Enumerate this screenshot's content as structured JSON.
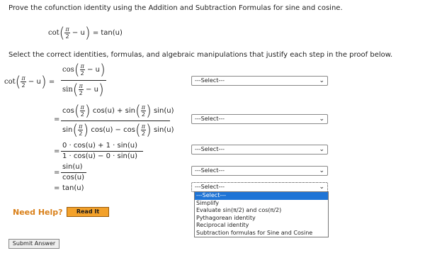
{
  "instruction": "Prove the cofunction identity using the Addition and Subtraction Formulas for sine and cosine.",
  "identity": {
    "lhs_fn": "cot",
    "pi": "π",
    "two": "2",
    "minus_u": "− u",
    "rhs": "= tan(u)"
  },
  "select_instruction": "Select the correct identities, formulas, and algebraic manipulations that justify each step in the proof below.",
  "proof": {
    "lhs_fn": "cot",
    "pi": "π",
    "two": "2",
    "minus_u": "− u",
    "eq": "=",
    "step1_num_fn": "cos",
    "step1_den_fn": "sin",
    "step2_num_a": "cos",
    "step2_num_b": "cos(u) + sin",
    "step2_num_c": "sin(u)",
    "step2_den_a": "sin",
    "step2_den_b": "cos(u) − cos",
    "step2_den_c": "sin(u)",
    "step3_num": "0 · cos(u) + 1 · sin(u)",
    "step3_den": "1 · cos(u) − 0 · sin(u)",
    "step4_num": "sin(u)",
    "step4_den": "cos(u)",
    "step5": "tan(u)"
  },
  "selects": [
    {
      "value": "---Select---"
    },
    {
      "value": "---Select---"
    },
    {
      "value": "---Select---"
    },
    {
      "value": "---Select---"
    },
    {
      "value": "---Select---"
    }
  ],
  "dropdown_options": [
    "---Select---",
    "Simplify",
    "Evaluate sin(π/2) and cos(π/2)",
    "Pythagorean identity",
    "Reciprocal identity",
    "Subtraction formulas for Sine and Cosine"
  ],
  "help": {
    "label": "Need Help?",
    "read_it": "Read It"
  },
  "submit": {
    "label": "Submit Answer"
  },
  "colors": {
    "help_text": "#d9801a",
    "read_it_bg": "#f3a12a",
    "highlight": "#1e74d6"
  }
}
